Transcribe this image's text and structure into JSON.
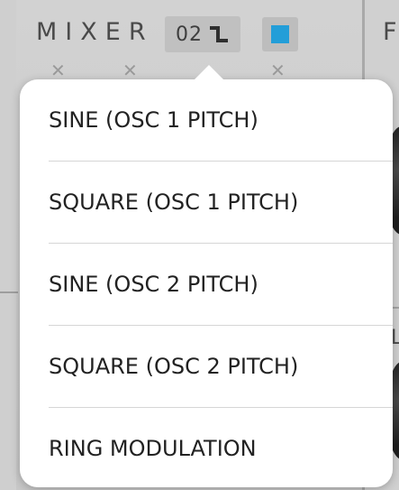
{
  "header": {
    "mixer_title": "MIXER",
    "osc_number": "02",
    "osc_wave_icon": "square-wave-icon",
    "color_swatch_hex": "#239ed8",
    "right_panel_letter": "F",
    "right_panel_letter_2": "L"
  },
  "popup_menu": {
    "items": [
      {
        "label": "SINE (OSC 1 PITCH)"
      },
      {
        "label": "SQUARE (OSC 1 PITCH)"
      },
      {
        "label": "SINE (OSC 2 PITCH)"
      },
      {
        "label": "SQUARE (OSC 2 PITCH)"
      },
      {
        "label": "RING MODULATION"
      }
    ]
  },
  "colors": {
    "accent_blue": "#239ed8",
    "popup_background": "#ffffff",
    "panel_background": "#cfcfcf",
    "menu_text": "#222222"
  }
}
